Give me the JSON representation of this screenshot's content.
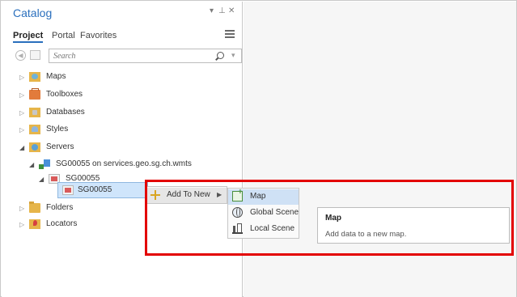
{
  "window": {
    "title": "Catalog",
    "controls": {
      "menu": "▾",
      "pin": "⊥",
      "close": "✕"
    }
  },
  "tabs": [
    {
      "label": "Project",
      "active": true
    },
    {
      "label": "Portal",
      "active": false
    },
    {
      "label": "Favorites",
      "active": false
    }
  ],
  "search": {
    "placeholder": "Search",
    "value": ""
  },
  "tree": [
    {
      "label": "Maps",
      "icon": "maps-folder-icon",
      "expanded": false
    },
    {
      "label": "Toolboxes",
      "icon": "toolbox-icon",
      "expanded": false
    },
    {
      "label": "Databases",
      "icon": "database-folder-icon",
      "expanded": false
    },
    {
      "label": "Styles",
      "icon": "styles-folder-icon",
      "expanded": false
    },
    {
      "label": "Servers",
      "icon": "servers-folder-icon",
      "expanded": true
    },
    {
      "label": "SG00055 on services.geo.sg.ch.wmts",
      "icon": "wmts-server-icon",
      "expanded": true
    },
    {
      "label": "SG00055",
      "icon": "layer-group-icon",
      "expanded": true
    },
    {
      "label": "SG00055",
      "icon": "layer-icon",
      "selected": true
    },
    {
      "label": "Folders",
      "icon": "folders-icon",
      "expanded": false
    },
    {
      "label": "Locators",
      "icon": "locators-icon",
      "expanded": false
    }
  ],
  "context_menu": {
    "items": [
      {
        "label": "Add To New",
        "icon": "add-icon",
        "has_submenu": true
      }
    ]
  },
  "submenu": {
    "items": [
      {
        "label": "Map",
        "icon": "new-map-icon",
        "highlighted": true
      },
      {
        "label": "Global Scene",
        "icon": "globe-scene-icon"
      },
      {
        "label": "Local Scene",
        "icon": "local-scene-icon"
      }
    ]
  },
  "tooltip": {
    "title": "Map",
    "description": "Add data to a new map."
  },
  "colors": {
    "accent": "#2a6fbd",
    "highlight_box": "#e30000",
    "selection": "#cfe5fb",
    "folder": "#e6b54a"
  }
}
